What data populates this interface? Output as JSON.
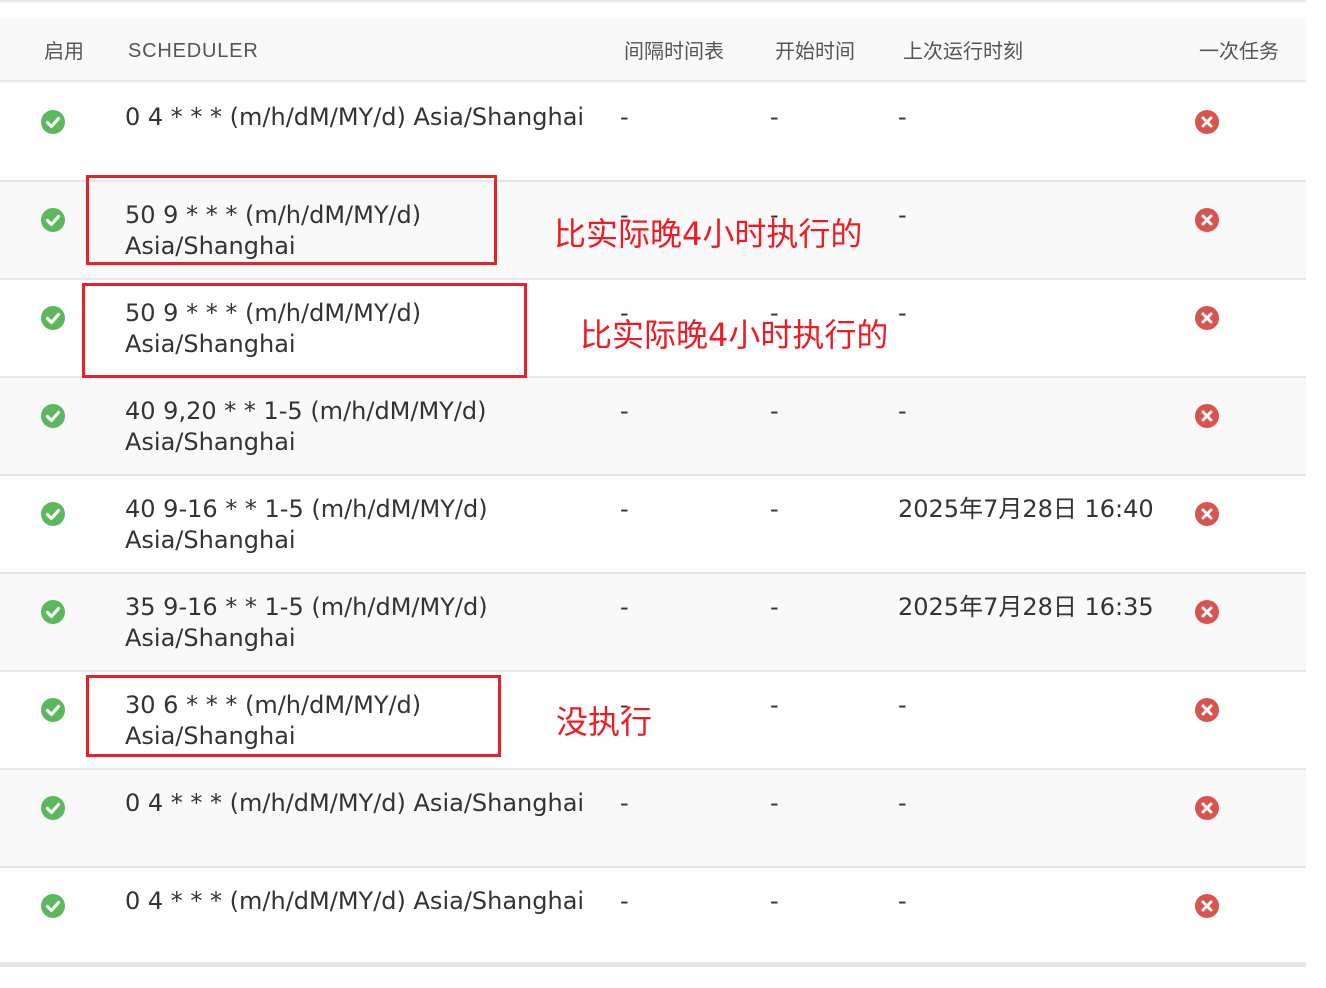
{
  "headers": {
    "enabled": "启用",
    "scheduler": "SCHEDULER",
    "interval": "间隔时间表",
    "start_time": "开始时间",
    "last_run": "上次运行时刻",
    "one_off": "一次任务"
  },
  "rows": [
    {
      "scheduler": "0 4 * * * (m/h/dM/MY/d) Asia/Shanghai",
      "interval": "-",
      "start": "-",
      "last_run": "-",
      "enabled": "check-icon",
      "one_off": "cross-icon"
    },
    {
      "scheduler": "50 9 * * * (m/h/dM/MY/d) Asia/Shanghai",
      "interval": "-",
      "start": "-",
      "last_run": "-",
      "enabled": "check-icon",
      "one_off": "cross-icon"
    },
    {
      "scheduler": "50 9 * * * (m/h/dM/MY/d) Asia/Shanghai",
      "interval": "-",
      "start": "-",
      "last_run": "-",
      "enabled": "check-icon",
      "one_off": "cross-icon"
    },
    {
      "scheduler": "40 9,20 * * 1-5 (m/h/dM/MY/d) Asia/Shanghai",
      "interval": "-",
      "start": "-",
      "last_run": "-",
      "enabled": "check-icon",
      "one_off": "cross-icon"
    },
    {
      "scheduler": "40 9-16 * * 1-5 (m/h/dM/MY/d) Asia/Shanghai",
      "interval": "-",
      "start": "-",
      "last_run": "2025年7月28日 16:40",
      "enabled": "check-icon",
      "one_off": "cross-icon"
    },
    {
      "scheduler": "35 9-16 * * 1-5 (m/h/dM/MY/d) Asia/Shanghai",
      "interval": "-",
      "start": "-",
      "last_run": "2025年7月28日 16:35",
      "enabled": "check-icon",
      "one_off": "cross-icon"
    },
    {
      "scheduler": "30 6 * * * (m/h/dM/MY/d) Asia/Shanghai",
      "interval": "-",
      "start": "-",
      "last_run": "-",
      "enabled": "check-icon",
      "one_off": "cross-icon"
    },
    {
      "scheduler": "0 4 * * * (m/h/dM/MY/d) Asia/Shanghai",
      "interval": "-",
      "start": "-",
      "last_run": "-",
      "enabled": "check-icon",
      "one_off": "cross-icon"
    },
    {
      "scheduler": "0 4 * * * (m/h/dM/MY/d) Asia/Shanghai",
      "interval": "-",
      "start": "-",
      "last_run": "-",
      "enabled": "check-icon",
      "one_off": "cross-icon"
    }
  ],
  "annotations": [
    {
      "text": "比实际晚4小时执行的"
    },
    {
      "text": "比实际晚4小时执行的"
    },
    {
      "text": "没执行"
    }
  ],
  "colors": {
    "enabled_icon": "#5cb85c",
    "one_off_icon": "#d9534f",
    "annotation": "#ee1b24",
    "row_alt": "#f9f9f9",
    "border": "#e6e6e6"
  }
}
